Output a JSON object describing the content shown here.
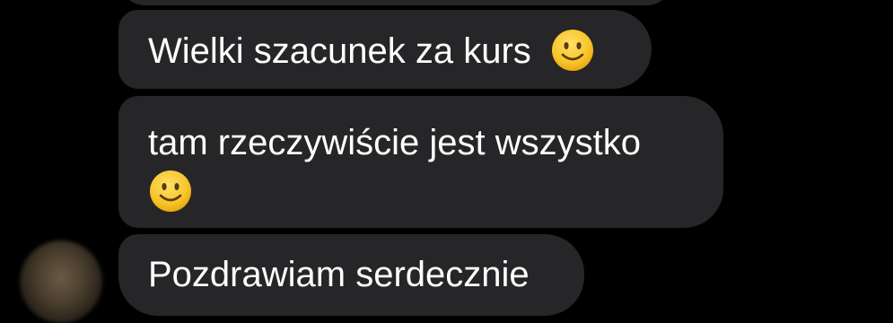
{
  "conversation": {
    "messages": [
      {
        "text": ""
      },
      {
        "text": "Wielki szacunek za kurs",
        "emoji": "slightly-smiling-face"
      },
      {
        "lines": [
          "tam rzeczywiście jest wszystko",
          ""
        ],
        "emoji": "slightly-smiling-face"
      },
      {
        "text": "Pozdrawiam serdecznie"
      }
    ],
    "avatar": {
      "icon": "blurred-profile-photo"
    }
  },
  "colors": {
    "background": "#000000",
    "bubble": "#262628",
    "text": "#ffffff",
    "emoji_face": "#f7c52b"
  }
}
